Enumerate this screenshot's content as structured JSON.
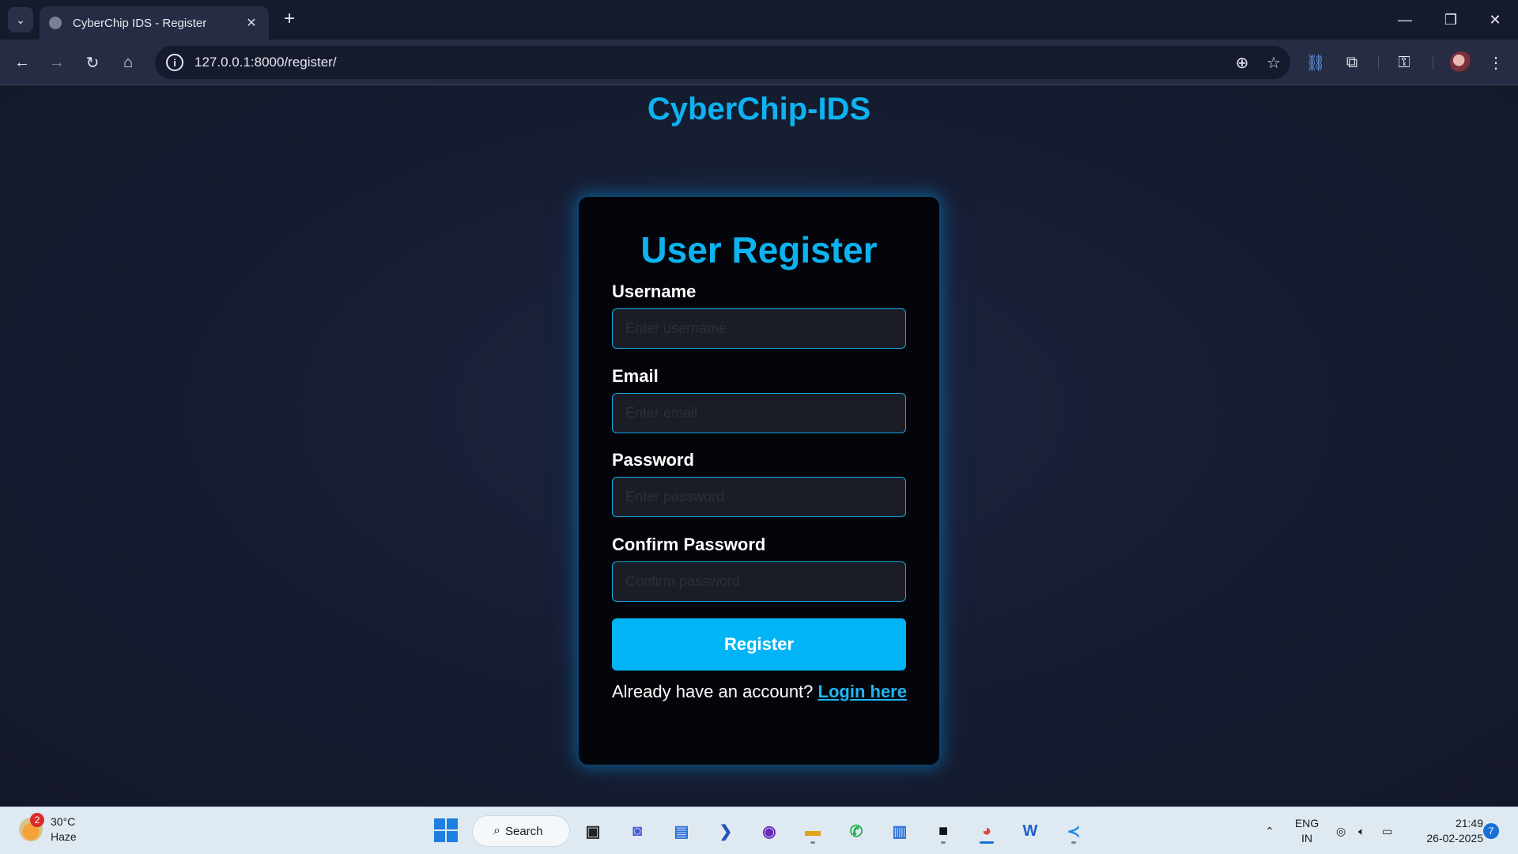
{
  "browser": {
    "tab_title": "CyberChip IDS - Register",
    "url": "127.0.0.1:8000/register/"
  },
  "page": {
    "site_title": "CyberChip-IDS",
    "form_title": "User Register",
    "fields": [
      {
        "label": "Username",
        "placeholder": "Enter username"
      },
      {
        "label": "Email",
        "placeholder": "Enter email"
      },
      {
        "label": "Password",
        "placeholder": "Enter password"
      },
      {
        "label": "Confirm Password",
        "placeholder": "Confirm password"
      }
    ],
    "register_label": "Register",
    "login_prompt": "Already have an account?",
    "login_link": "Login here"
  },
  "taskbar": {
    "weather_badge": "2",
    "weather_temp": "30°C",
    "weather_desc": "Haze",
    "search_label": "Search",
    "lang_top": "ENG",
    "lang_bottom": "IN",
    "time": "21:49",
    "date": "26-02-2025",
    "notification_count": "7"
  },
  "colors": {
    "accent": "#0db3f0",
    "button": "#00b4f5",
    "card_bg": "#03050b",
    "page_bg": "#1a1f33"
  }
}
